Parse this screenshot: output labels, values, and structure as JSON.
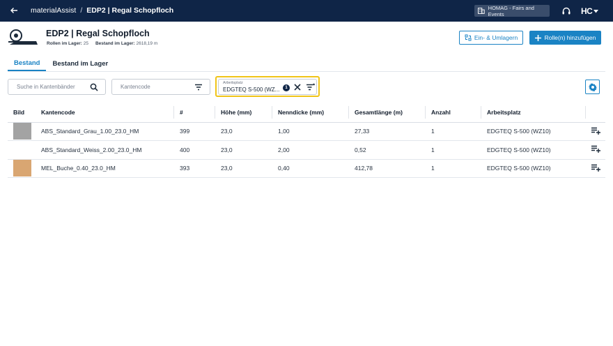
{
  "header": {
    "app_name": "materialAssist",
    "separator": "/",
    "current": "EDP2 | Regal Schopfloch",
    "org_label": "HOMAG - Fairs and Events",
    "logo_text": "HC"
  },
  "page": {
    "title": "EDP2 | Regal Schopfloch",
    "meta": {
      "rolls_label": "Rollen im Lager:",
      "rolls_value": "25",
      "stock_label": "Bestand im Lager:",
      "stock_value": "2618,19 m"
    },
    "actions": {
      "move_label": "Ein- & Umlagern",
      "add_label": "Rolle(n) hinzufügen"
    }
  },
  "tabs": [
    {
      "label": "Bestand",
      "active": true
    },
    {
      "label": "Bestand im Lager",
      "active": false
    }
  ],
  "filters": {
    "search_placeholder": "Suche in Kantenbänder",
    "kantencode_placeholder": "Kantencode",
    "arbeitsplatz_label": "Arbeitsplatz",
    "arbeitsplatz_value": "EDGTEQ S-500 (WZ...",
    "arbeitsplatz_count": "1"
  },
  "table": {
    "columns": [
      "Bild",
      "Kantencode",
      "#",
      "Höhe (mm)",
      "Nenndicke (mm)",
      "Gesamtlänge (m)",
      "Anzahl",
      "Arbeitsplatz"
    ],
    "rows": [
      {
        "swatch": "#a3a3a3",
        "kantencode": "ABS_Standard_Grau_1.00_23.0_HM",
        "nr": "399",
        "hoehe": "23,0",
        "nenndicke": "1,00",
        "laenge": "27,33",
        "anzahl": "1",
        "arbeitsplatz": "EDGTEQ S-500 (WZ10)"
      },
      {
        "swatch": "#ffffff",
        "kantencode": "ABS_Standard_Weiss_2.00_23.0_HM",
        "nr": "400",
        "hoehe": "23,0",
        "nenndicke": "2,00",
        "laenge": "0,52",
        "anzahl": "1",
        "arbeitsplatz": "EDGTEQ S-500 (WZ10)"
      },
      {
        "swatch": "#d9a672",
        "kantencode": "MEL_Buche_0.40_23.0_HM",
        "nr": "393",
        "hoehe": "23,0",
        "nenndicke": "0,40",
        "laenge": "412,78",
        "anzahl": "1",
        "arbeitsplatz": "EDGTEQ S-500 (WZ10)"
      }
    ]
  },
  "colors": {
    "header_bg": "#0f2547",
    "accent": "#1a83c4",
    "focus": "#f0c419"
  },
  "icons": [
    "arrow-left-icon",
    "building-icon",
    "headset-icon",
    "logo-icon",
    "chevron-down-icon",
    "roll-icon",
    "transfer-icon",
    "plus-icon",
    "search-icon",
    "filter-icon",
    "clear-icon",
    "filter-settings-icon",
    "gear-icon",
    "playlist-add-icon"
  ]
}
